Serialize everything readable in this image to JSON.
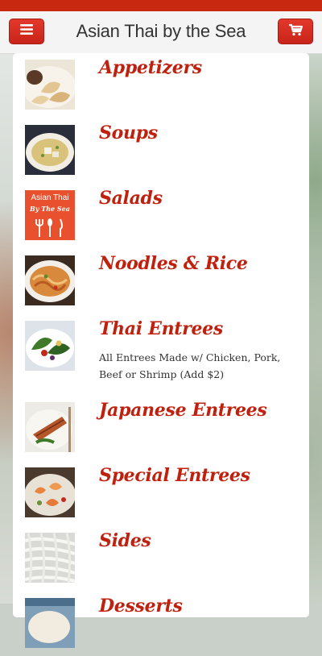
{
  "header": {
    "title": "Asian Thai by the Sea",
    "menu_icon": "hamburger-icon",
    "cart_icon": "shopping-cart-icon",
    "accent_color": "#c8280f"
  },
  "menu": {
    "categories": [
      {
        "label": "Appetizers",
        "image": "dumplings"
      },
      {
        "label": "Soups",
        "image": "soup-bowl"
      },
      {
        "label": "Salads",
        "logo_text": "Asian Thai",
        "logo_script": "By The Sea"
      },
      {
        "label": "Noodles & Rice",
        "image": "noodles"
      },
      {
        "label": "Thai Entrees",
        "description": "All Entrees Made w/ Chicken, Pork, Beef or Shrimp (Add $2)",
        "image": "thai-dish"
      },
      {
        "label": "Japanese Entrees",
        "image": "grilled-fish"
      },
      {
        "label": "Special Entrees",
        "image": "shrimp-dish"
      },
      {
        "label": "Sides",
        "image": "rice-noodles"
      },
      {
        "label": "Desserts",
        "image": "dessert"
      }
    ]
  }
}
